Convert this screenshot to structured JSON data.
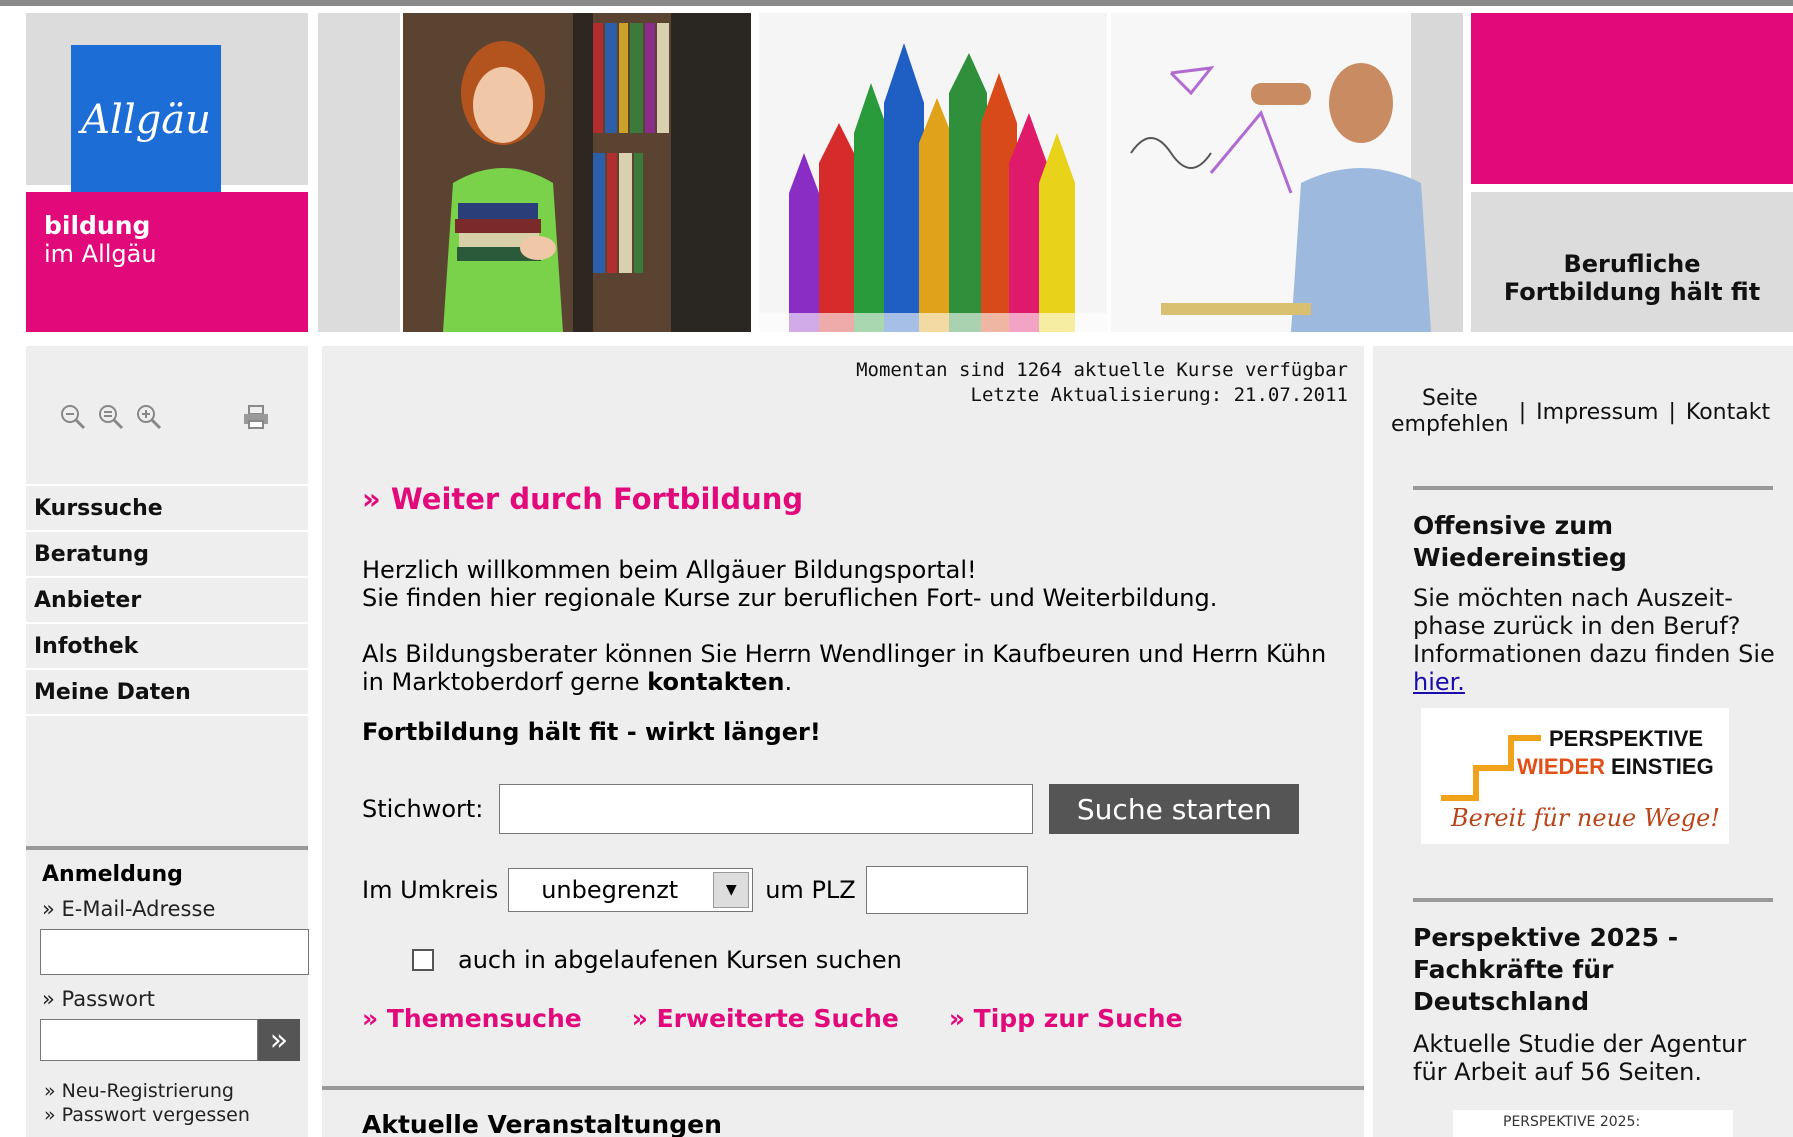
{
  "brand": {
    "logo_text": "Allgäu",
    "title_line1": "bildung",
    "title_line2": "im Allgäu"
  },
  "header": {
    "slogan": "Berufliche Fortbildung hält fit",
    "colors": {
      "accent": "#e2097b",
      "logo_blue": "#1d6dd6",
      "panel_gray": "#dcdcdc"
    }
  },
  "tools": [
    "zoom-out-icon",
    "zoom-reset-icon",
    "zoom-in-icon",
    "print-icon"
  ],
  "nav": {
    "items": [
      {
        "label": "Kurssuche"
      },
      {
        "label": "Beratung"
      },
      {
        "label": "Anbieter"
      },
      {
        "label": "Infothek"
      },
      {
        "label": "Meine Daten"
      }
    ]
  },
  "login": {
    "title": "Anmeldung",
    "email_label": "» E-Mail-Adresse",
    "password_label": "» Passwort",
    "submit_symbol": "»",
    "register_link": "» Neu-Registrierung",
    "forgot_link": "» Passwort vergessen"
  },
  "main": {
    "status_line1": "Momentan sind 1264 aktuelle Kurse verfügbar",
    "status_line2": "Letzte Aktualisierung: 21.07.2011",
    "heading": "» Weiter durch Fortbildung",
    "intro_line1": "Herzlich willkommen beim Allgäuer Bildungsportal!",
    "intro_line2": "Sie finden hier regionale Kurse zur beruflichen Fort- und Weiterbildung.",
    "advisor_text": "Als Bildungsberater können Sie Herrn Wendlinger in Kaufbeuren und Herrn Kühn in Marktoberdorf gerne ",
    "advisor_link": "kontakten",
    "advisor_end": ".",
    "slogan": "Fortbildung hält fit - wirkt länger!",
    "search": {
      "keyword_label": "Stichwort:",
      "keyword_value": "",
      "button_label": "Suche starten",
      "radius_label": "Im Umkreis",
      "radius_value": "unbegrenzt",
      "plz_label": "um PLZ",
      "plz_value": "",
      "expired_checkbox_label": "auch in abgelaufenen Kursen suchen",
      "expired_checked": false
    },
    "links": [
      "» Themensuche",
      "» Erweiterte Suche",
      "» Tipp zur Suche"
    ],
    "events_heading": "Aktuelle Veranstaltungen"
  },
  "right": {
    "recommend_line1": "Seite",
    "recommend_line2": "empfehlen",
    "separator": "|",
    "imprint": "Impressum",
    "contact": "Kontakt",
    "box1": {
      "heading": "Offensive zum Wiedereinstieg",
      "text": "Sie möchten nach Auszeit-phase zurück in den Beruf? Informationen dazu finden Sie ",
      "link": "hier.",
      "logo_line1": "PERSPEKTIVE",
      "logo_line2a": "WIEDER",
      "logo_line2b": "EINSTIEG",
      "logo_script": "Bereit für neue Wege!"
    },
    "box2": {
      "heading": "Perspektive 2025 - Fachkräfte für Deutschland",
      "text": "Aktuelle Studie der Agentur für Arbeit auf 56 Seiten.",
      "thumb_text": "PERSPEKTIVE 2025:"
    }
  }
}
